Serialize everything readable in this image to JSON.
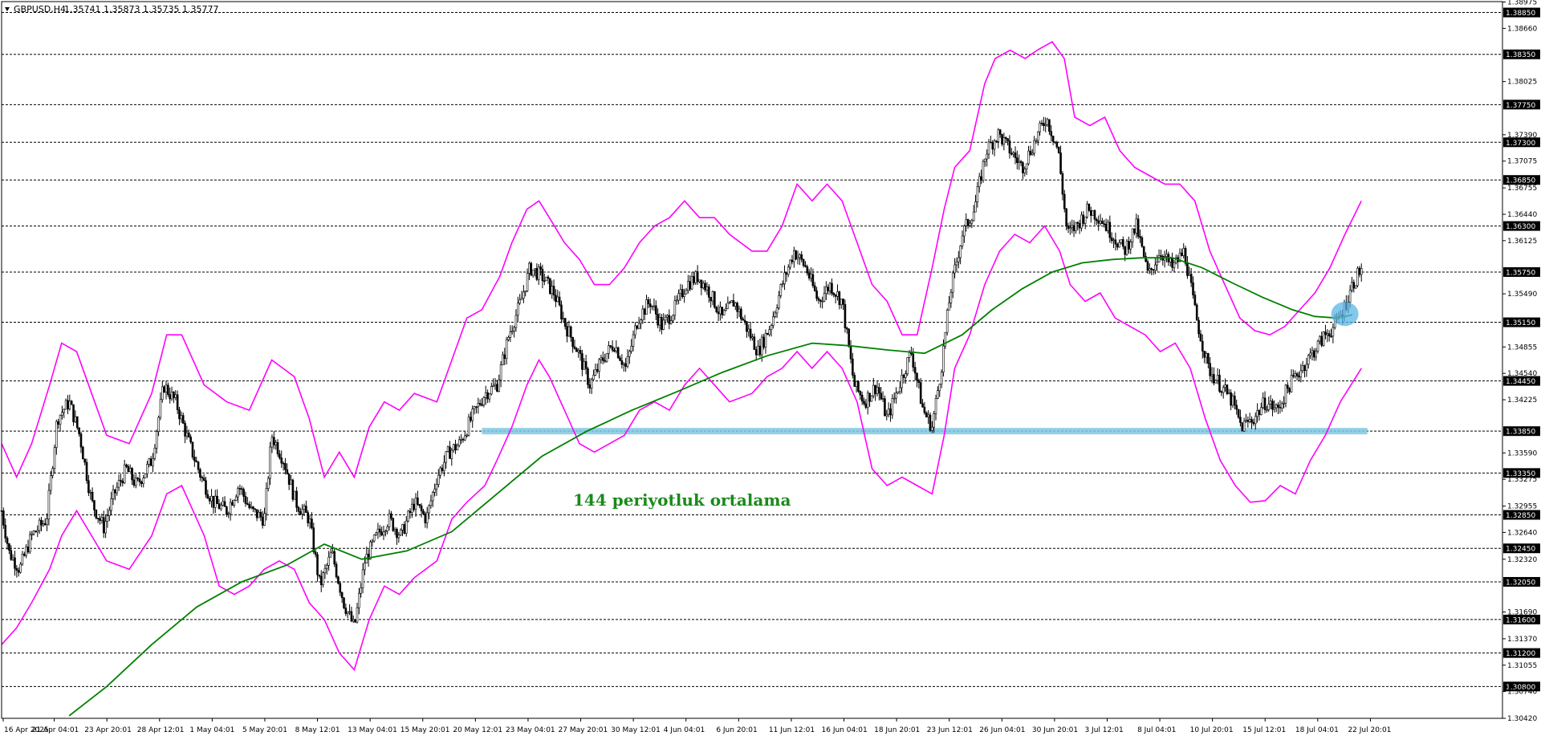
{
  "header": {
    "symbol": "GBPUSD,H4",
    "ohlc": "1.35741 1.35873 1.35735 1.35777",
    "menu_icon": "triangle-down-icon"
  },
  "colors": {
    "candle": "#000000",
    "bollinger": "#ff00ff",
    "ma": "#008000",
    "support_zone": "#7ec8e3",
    "highlight": "#5ab4e6",
    "grid": "#000000"
  },
  "annotation": {
    "text": "144 periyotluk ortalama"
  },
  "chart_data": {
    "type": "candlestick",
    "price_range": [
      1.3042,
      1.3898
    ],
    "y_ticks": [
      "1.38975",
      "1.38660",
      "1.38025",
      "1.37390",
      "1.37075",
      "1.36755",
      "1.36440",
      "1.36125",
      "1.35490",
      "1.34855",
      "1.34540",
      "1.34225",
      "1.33590",
      "1.33275",
      "1.32955",
      "1.32640",
      "1.32320",
      "1.31690",
      "1.31370",
      "1.31055",
      "1.30740",
      "1.30420"
    ],
    "horizontal_levels": [
      "1.38850",
      "1.38350",
      "1.37750",
      "1.37300",
      "1.36850",
      "1.36300",
      "1.35750",
      "1.35150",
      "1.34450",
      "1.33850",
      "1.33350",
      "1.32850",
      "1.32450",
      "1.32050",
      "1.31600",
      "1.31200",
      "1.30800"
    ],
    "x_labels": [
      "16 Apr 2025",
      "21 Apr 04:01",
      "23 Apr 20:01",
      "28 Apr 12:01",
      "1 May 04:01",
      "5 May 20:01",
      "8 May 12:01",
      "13 May 04:01",
      "15 May 20:01",
      "20 May 12:01",
      "23 May 04:01",
      "27 May 20:01",
      "30 May 12:01",
      "4 Jun 04:01",
      "6 Jun 20:01",
      "11 Jun 12:01",
      "16 Jun 04:01",
      "18 Jun 20:01",
      "23 Jun 12:01",
      "26 Jun 04:01",
      "30 Jun 20:01",
      "3 Jul 12:01",
      "8 Jul 04:01",
      "10 Jul 20:01",
      "15 Jul 12:01",
      "18 Jul 04:01",
      "22 Jul 20:01"
    ],
    "close_path": [
      [
        0,
        1.329
      ],
      [
        0.005,
        1.324
      ],
      [
        0.012,
        1.322
      ],
      [
        0.02,
        1.326
      ],
      [
        0.03,
        1.328
      ],
      [
        0.037,
        1.34
      ],
      [
        0.045,
        1.342
      ],
      [
        0.052,
        1.338
      ],
      [
        0.06,
        1.33
      ],
      [
        0.068,
        1.327
      ],
      [
        0.075,
        1.331
      ],
      [
        0.083,
        1.334
      ],
      [
        0.09,
        1.332
      ],
      [
        0.1,
        1.335
      ],
      [
        0.108,
        1.344
      ],
      [
        0.116,
        1.342
      ],
      [
        0.125,
        1.337
      ],
      [
        0.133,
        1.333
      ],
      [
        0.141,
        1.33
      ],
      [
        0.15,
        1.329
      ],
      [
        0.158,
        1.332
      ],
      [
        0.166,
        1.329
      ],
      [
        0.175,
        1.328
      ],
      [
        0.18,
        1.338
      ],
      [
        0.188,
        1.335
      ],
      [
        0.196,
        1.33
      ],
      [
        0.205,
        1.328
      ],
      [
        0.212,
        1.32
      ],
      [
        0.22,
        1.324
      ],
      [
        0.228,
        1.318
      ],
      [
        0.235,
        1.315
      ],
      [
        0.242,
        1.323
      ],
      [
        0.25,
        1.326
      ],
      [
        0.258,
        1.328
      ],
      [
        0.266,
        1.326
      ],
      [
        0.275,
        1.33
      ],
      [
        0.283,
        1.328
      ],
      [
        0.29,
        1.333
      ],
      [
        0.298,
        1.336
      ],
      [
        0.305,
        1.337
      ],
      [
        0.313,
        1.34
      ],
      [
        0.322,
        1.343
      ],
      [
        0.33,
        1.344
      ],
      [
        0.338,
        1.35
      ],
      [
        0.346,
        1.354
      ],
      [
        0.352,
        1.358
      ],
      [
        0.36,
        1.357
      ],
      [
        0.368,
        1.355
      ],
      [
        0.376,
        1.351
      ],
      [
        0.384,
        1.348
      ],
      [
        0.392,
        1.344
      ],
      [
        0.4,
        1.347
      ],
      [
        0.408,
        1.349
      ],
      [
        0.416,
        1.346
      ],
      [
        0.424,
        1.352
      ],
      [
        0.432,
        1.354
      ],
      [
        0.44,
        1.351
      ],
      [
        0.448,
        1.353
      ],
      [
        0.456,
        1.356
      ],
      [
        0.464,
        1.357
      ],
      [
        0.472,
        1.355
      ],
      [
        0.48,
        1.352
      ],
      [
        0.488,
        1.354
      ],
      [
        0.496,
        1.351
      ],
      [
        0.504,
        1.348
      ],
      [
        0.512,
        1.351
      ],
      [
        0.52,
        1.356
      ],
      [
        0.528,
        1.36
      ],
      [
        0.536,
        1.358
      ],
      [
        0.544,
        1.354
      ],
      [
        0.552,
        1.356
      ],
      [
        0.56,
        1.354
      ],
      [
        0.568,
        1.344
      ],
      [
        0.575,
        1.342
      ],
      [
        0.583,
        1.344
      ],
      [
        0.59,
        1.34
      ],
      [
        0.598,
        1.344
      ],
      [
        0.606,
        1.348
      ],
      [
        0.614,
        1.341
      ],
      [
        0.62,
        1.339
      ],
      [
        0.626,
        1.346
      ],
      [
        0.632,
        1.355
      ],
      [
        0.64,
        1.362
      ],
      [
        0.648,
        1.365
      ],
      [
        0.656,
        1.372
      ],
      [
        0.664,
        1.374
      ],
      [
        0.672,
        1.372
      ],
      [
        0.68,
        1.37
      ],
      [
        0.688,
        1.373
      ],
      [
        0.696,
        1.376
      ],
      [
        0.704,
        1.372
      ],
      [
        0.71,
        1.362
      ],
      [
        0.716,
        1.363
      ],
      [
        0.724,
        1.365
      ],
      [
        0.732,
        1.364
      ],
      [
        0.74,
        1.362
      ],
      [
        0.748,
        1.36
      ],
      [
        0.756,
        1.363
      ],
      [
        0.764,
        1.357
      ],
      [
        0.772,
        1.36
      ],
      [
        0.78,
        1.358
      ],
      [
        0.788,
        1.36
      ],
      [
        0.796,
        1.352
      ],
      [
        0.804,
        1.346
      ],
      [
        0.812,
        1.344
      ],
      [
        0.82,
        1.342
      ],
      [
        0.826,
        1.339
      ],
      [
        0.834,
        1.34
      ],
      [
        0.842,
        1.342
      ],
      [
        0.85,
        1.341
      ],
      [
        0.858,
        1.344
      ],
      [
        0.866,
        1.346
      ],
      [
        0.874,
        1.348
      ],
      [
        0.882,
        1.35
      ],
      [
        0.888,
        1.351
      ],
      [
        0.894,
        1.353
      ],
      [
        0.9,
        1.356
      ],
      [
        0.906,
        1.358
      ]
    ],
    "ma_path": [
      [
        0.045,
        1.3045
      ],
      [
        0.07,
        1.308
      ],
      [
        0.1,
        1.313
      ],
      [
        0.13,
        1.3175
      ],
      [
        0.16,
        1.3205
      ],
      [
        0.19,
        1.3225
      ],
      [
        0.215,
        1.325
      ],
      [
        0.24,
        1.3232
      ],
      [
        0.27,
        1.3242
      ],
      [
        0.3,
        1.3265
      ],
      [
        0.33,
        1.331
      ],
      [
        0.36,
        1.3355
      ],
      [
        0.39,
        1.3385
      ],
      [
        0.42,
        1.341
      ],
      [
        0.45,
        1.3432
      ],
      [
        0.48,
        1.3455
      ],
      [
        0.51,
        1.3475
      ],
      [
        0.54,
        1.349
      ],
      [
        0.565,
        1.3487
      ],
      [
        0.59,
        1.3482
      ],
      [
        0.615,
        1.3478
      ],
      [
        0.64,
        1.35
      ],
      [
        0.66,
        1.353
      ],
      [
        0.68,
        1.3555
      ],
      [
        0.7,
        1.3575
      ],
      [
        0.72,
        1.3586
      ],
      [
        0.74,
        1.359
      ],
      [
        0.76,
        1.3592
      ],
      [
        0.78,
        1.3592
      ],
      [
        0.8,
        1.358
      ],
      [
        0.82,
        1.3562
      ],
      [
        0.84,
        1.3545
      ],
      [
        0.86,
        1.353
      ],
      [
        0.875,
        1.3522
      ],
      [
        0.89,
        1.352
      ],
      [
        0.9,
        1.3524
      ]
    ],
    "bb_upper_path": [
      [
        0,
        1.337
      ],
      [
        0.01,
        1.333
      ],
      [
        0.02,
        1.337
      ],
      [
        0.032,
        1.344
      ],
      [
        0.04,
        1.349
      ],
      [
        0.05,
        1.348
      ],
      [
        0.06,
        1.343
      ],
      [
        0.07,
        1.338
      ],
      [
        0.085,
        1.337
      ],
      [
        0.1,
        1.343
      ],
      [
        0.11,
        1.35
      ],
      [
        0.12,
        1.35
      ],
      [
        0.135,
        1.344
      ],
      [
        0.15,
        1.342
      ],
      [
        0.165,
        1.341
      ],
      [
        0.18,
        1.347
      ],
      [
        0.195,
        1.345
      ],
      [
        0.205,
        1.34
      ],
      [
        0.215,
        1.333
      ],
      [
        0.225,
        1.336
      ],
      [
        0.235,
        1.333
      ],
      [
        0.245,
        1.339
      ],
      [
        0.255,
        1.342
      ],
      [
        0.265,
        1.341
      ],
      [
        0.275,
        1.343
      ],
      [
        0.29,
        1.342
      ],
      [
        0.3,
        1.347
      ],
      [
        0.31,
        1.352
      ],
      [
        0.32,
        1.353
      ],
      [
        0.332,
        1.357
      ],
      [
        0.34,
        1.361
      ],
      [
        0.35,
        1.365
      ],
      [
        0.358,
        1.366
      ],
      [
        0.365,
        1.364
      ],
      [
        0.375,
        1.361
      ],
      [
        0.385,
        1.359
      ],
      [
        0.395,
        1.356
      ],
      [
        0.405,
        1.356
      ],
      [
        0.415,
        1.358
      ],
      [
        0.425,
        1.361
      ],
      [
        0.435,
        1.363
      ],
      [
        0.445,
        1.364
      ],
      [
        0.455,
        1.366
      ],
      [
        0.465,
        1.364
      ],
      [
        0.475,
        1.364
      ],
      [
        0.485,
        1.362
      ],
      [
        0.5,
        1.36
      ],
      [
        0.51,
        1.36
      ],
      [
        0.52,
        1.363
      ],
      [
        0.53,
        1.368
      ],
      [
        0.54,
        1.366
      ],
      [
        0.55,
        1.368
      ],
      [
        0.56,
        1.366
      ],
      [
        0.57,
        1.361
      ],
      [
        0.58,
        1.356
      ],
      [
        0.59,
        1.354
      ],
      [
        0.6,
        1.35
      ],
      [
        0.61,
        1.35
      ],
      [
        0.62,
        1.358
      ],
      [
        0.628,
        1.365
      ],
      [
        0.635,
        1.37
      ],
      [
        0.645,
        1.372
      ],
      [
        0.655,
        1.38
      ],
      [
        0.662,
        1.383
      ],
      [
        0.672,
        1.384
      ],
      [
        0.682,
        1.383
      ],
      [
        0.69,
        1.384
      ],
      [
        0.7,
        1.385
      ],
      [
        0.708,
        1.383
      ],
      [
        0.715,
        1.376
      ],
      [
        0.725,
        1.375
      ],
      [
        0.735,
        1.376
      ],
      [
        0.745,
        1.372
      ],
      [
        0.755,
        1.37
      ],
      [
        0.765,
        1.369
      ],
      [
        0.775,
        1.368
      ],
      [
        0.785,
        1.368
      ],
      [
        0.795,
        1.366
      ],
      [
        0.805,
        1.36
      ],
      [
        0.815,
        1.356
      ],
      [
        0.825,
        1.352
      ],
      [
        0.835,
        1.3505
      ],
      [
        0.845,
        1.35
      ],
      [
        0.855,
        1.351
      ],
      [
        0.865,
        1.353
      ],
      [
        0.875,
        1.355
      ],
      [
        0.885,
        1.358
      ],
      [
        0.895,
        1.362
      ],
      [
        0.906,
        1.366
      ]
    ],
    "bb_lower_path": [
      [
        0,
        1.313
      ],
      [
        0.01,
        1.315
      ],
      [
        0.02,
        1.318
      ],
      [
        0.032,
        1.322
      ],
      [
        0.04,
        1.326
      ],
      [
        0.05,
        1.329
      ],
      [
        0.06,
        1.326
      ],
      [
        0.07,
        1.323
      ],
      [
        0.085,
        1.322
      ],
      [
        0.1,
        1.326
      ],
      [
        0.11,
        1.331
      ],
      [
        0.12,
        1.332
      ],
      [
        0.135,
        1.326
      ],
      [
        0.145,
        1.32
      ],
      [
        0.155,
        1.319
      ],
      [
        0.165,
        1.32
      ],
      [
        0.175,
        1.322
      ],
      [
        0.185,
        1.323
      ],
      [
        0.195,
        1.322
      ],
      [
        0.205,
        1.318
      ],
      [
        0.215,
        1.316
      ],
      [
        0.225,
        1.312
      ],
      [
        0.235,
        1.31
      ],
      [
        0.245,
        1.316
      ],
      [
        0.255,
        1.32
      ],
      [
        0.265,
        1.319
      ],
      [
        0.275,
        1.321
      ],
      [
        0.29,
        1.323
      ],
      [
        0.3,
        1.328
      ],
      [
        0.31,
        1.33
      ],
      [
        0.322,
        1.332
      ],
      [
        0.33,
        1.335
      ],
      [
        0.34,
        1.339
      ],
      [
        0.35,
        1.344
      ],
      [
        0.358,
        1.347
      ],
      [
        0.365,
        1.345
      ],
      [
        0.375,
        1.341
      ],
      [
        0.385,
        1.337
      ],
      [
        0.395,
        1.336
      ],
      [
        0.405,
        1.337
      ],
      [
        0.415,
        1.338
      ],
      [
        0.425,
        1.341
      ],
      [
        0.435,
        1.342
      ],
      [
        0.445,
        1.341
      ],
      [
        0.455,
        1.344
      ],
      [
        0.465,
        1.346
      ],
      [
        0.475,
        1.344
      ],
      [
        0.485,
        1.342
      ],
      [
        0.5,
        1.343
      ],
      [
        0.51,
        1.345
      ],
      [
        0.52,
        1.346
      ],
      [
        0.53,
        1.348
      ],
      [
        0.54,
        1.346
      ],
      [
        0.55,
        1.348
      ],
      [
        0.56,
        1.346
      ],
      [
        0.57,
        1.342
      ],
      [
        0.58,
        1.334
      ],
      [
        0.59,
        1.332
      ],
      [
        0.6,
        1.333
      ],
      [
        0.61,
        1.332
      ],
      [
        0.62,
        1.331
      ],
      [
        0.628,
        1.338
      ],
      [
        0.635,
        1.346
      ],
      [
        0.645,
        1.35
      ],
      [
        0.655,
        1.356
      ],
      [
        0.665,
        1.36
      ],
      [
        0.675,
        1.362
      ],
      [
        0.685,
        1.361
      ],
      [
        0.695,
        1.363
      ],
      [
        0.705,
        1.36
      ],
      [
        0.712,
        1.356
      ],
      [
        0.722,
        1.354
      ],
      [
        0.732,
        1.355
      ],
      [
        0.742,
        1.352
      ],
      [
        0.752,
        1.351
      ],
      [
        0.762,
        1.35
      ],
      [
        0.772,
        1.348
      ],
      [
        0.782,
        1.349
      ],
      [
        0.792,
        1.346
      ],
      [
        0.802,
        1.34
      ],
      [
        0.812,
        1.335
      ],
      [
        0.822,
        1.332
      ],
      [
        0.832,
        1.33
      ],
      [
        0.842,
        1.3302
      ],
      [
        0.852,
        1.332
      ],
      [
        0.862,
        1.331
      ],
      [
        0.872,
        1.335
      ],
      [
        0.882,
        1.338
      ],
      [
        0.892,
        1.342
      ],
      [
        0.906,
        1.346
      ]
    ]
  }
}
